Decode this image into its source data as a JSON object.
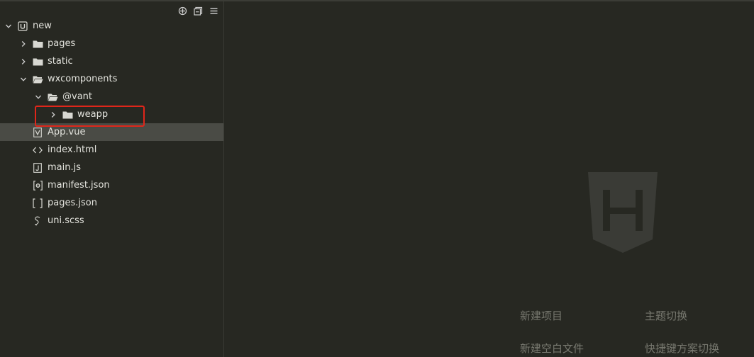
{
  "colors": {
    "background": "#272822",
    "text": "#e2e2dc",
    "selected_row": "#4a4b45",
    "highlight_border": "#e0261a",
    "muted_text": "#77786f",
    "logo": "#3a3b36"
  },
  "toolbar": {
    "icons": [
      "target-icon",
      "collapse-all-icon",
      "menu-icon"
    ]
  },
  "tree": {
    "root": {
      "label": "new",
      "icon": "uni-project-icon",
      "expanded": true
    },
    "pages": {
      "label": "pages",
      "icon": "folder-icon",
      "expanded": false
    },
    "static": {
      "label": "static",
      "icon": "folder-icon",
      "expanded": false
    },
    "wxcomponents": {
      "label": "wxcomponents",
      "icon": "folder-open-icon",
      "expanded": true
    },
    "vant": {
      "label": "@vant",
      "icon": "folder-open-icon",
      "expanded": true
    },
    "weapp": {
      "label": "weapp",
      "icon": "folder-icon",
      "expanded": false
    },
    "app_vue": {
      "label": "App.vue",
      "icon": "vue-file-icon"
    },
    "index_html": {
      "label": "index.html",
      "icon": "html-file-icon"
    },
    "main_js": {
      "label": "main.js",
      "icon": "js-file-icon"
    },
    "manifest_json": {
      "label": "manifest.json",
      "icon": "manifest-file-icon"
    },
    "pages_json": {
      "label": "pages.json",
      "icon": "json-file-icon"
    },
    "uni_scss": {
      "label": "uni.scss",
      "icon": "scss-file-icon"
    }
  },
  "welcome": {
    "new_project": "新建项目",
    "switch_theme": "主题切换",
    "new_blank_file": "新建空白文件",
    "switch_keymap": "快捷键方案切换"
  }
}
